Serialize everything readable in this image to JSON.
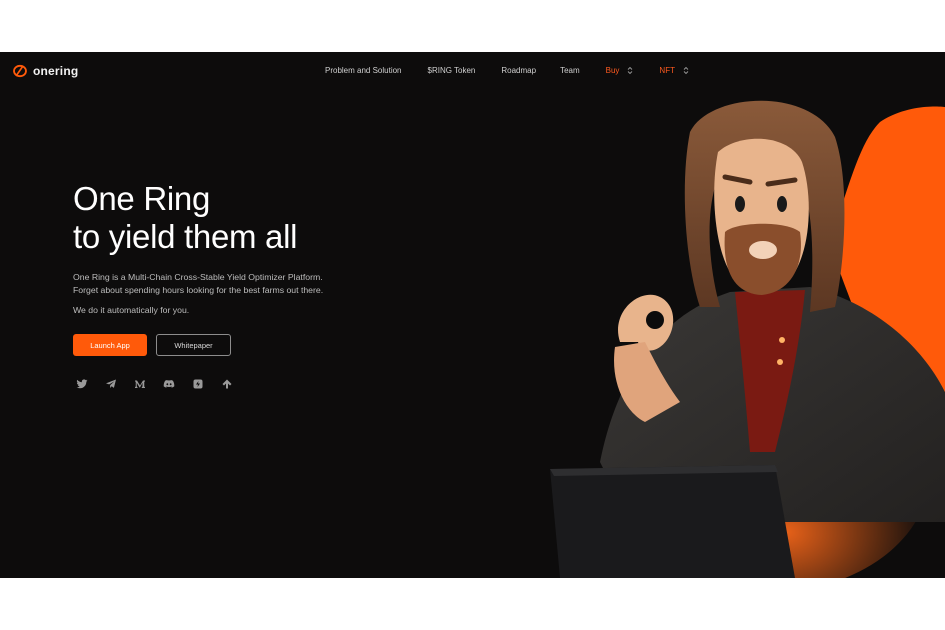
{
  "brand": {
    "name": "onering",
    "accent_color": "#ff5a0a"
  },
  "nav": {
    "items": [
      {
        "label": "Problem and Solution"
      },
      {
        "label": "$RING Token"
      },
      {
        "label": "Roadmap"
      },
      {
        "label": "Team"
      },
      {
        "label": "Buy",
        "dropdown": true
      },
      {
        "label": "NFT",
        "dropdown": true
      }
    ]
  },
  "hero": {
    "title_line1": "One Ring",
    "title_line2": "to yield them all",
    "description_line1": "One Ring is a Multi-Chain Cross-Stable Yield Optimizer Platform.",
    "description_line2": "Forget about spending hours looking for the best farms out there.",
    "tagline": "We do it automatically for you.",
    "primary_button": "Launch App",
    "secondary_button": "Whitepaper"
  },
  "socials": [
    "twitter-icon",
    "telegram-icon",
    "medium-icon",
    "discord-icon",
    "snapshot-icon",
    "gitbook-icon"
  ]
}
